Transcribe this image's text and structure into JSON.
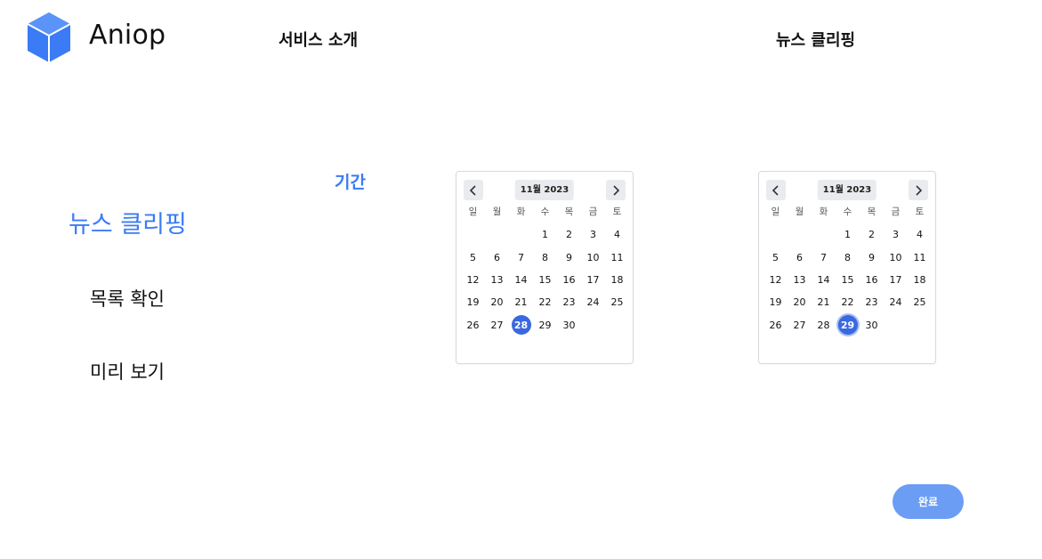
{
  "header": {
    "brand": "Aniop",
    "logo_icon": "cube-icon",
    "nav": [
      {
        "label": "서비스 소개"
      },
      {
        "label": "뉴스 클리핑"
      }
    ]
  },
  "sidebar": {
    "title": "뉴스 클리핑",
    "items": [
      {
        "label": "목록 확인"
      },
      {
        "label": "미리 보기"
      }
    ]
  },
  "period_label": "기간",
  "calendars": [
    {
      "month_label": "11월 2023",
      "weekdays": [
        "일",
        "월",
        "화",
        "수",
        "목",
        "금",
        "토"
      ],
      "first_weekday": 3,
      "days_in_month": 30,
      "selected_day": 28
    },
    {
      "month_label": "11월 2023",
      "weekdays": [
        "일",
        "월",
        "화",
        "수",
        "목",
        "금",
        "토"
      ],
      "first_weekday": 3,
      "days_in_month": 30,
      "selected_day": 29
    }
  ],
  "done_button": "완료",
  "colors": {
    "accent": "#3b7bf5",
    "selected_day": "#3a68df",
    "button": "#6b9df5",
    "logo": "#3b7bf5"
  }
}
